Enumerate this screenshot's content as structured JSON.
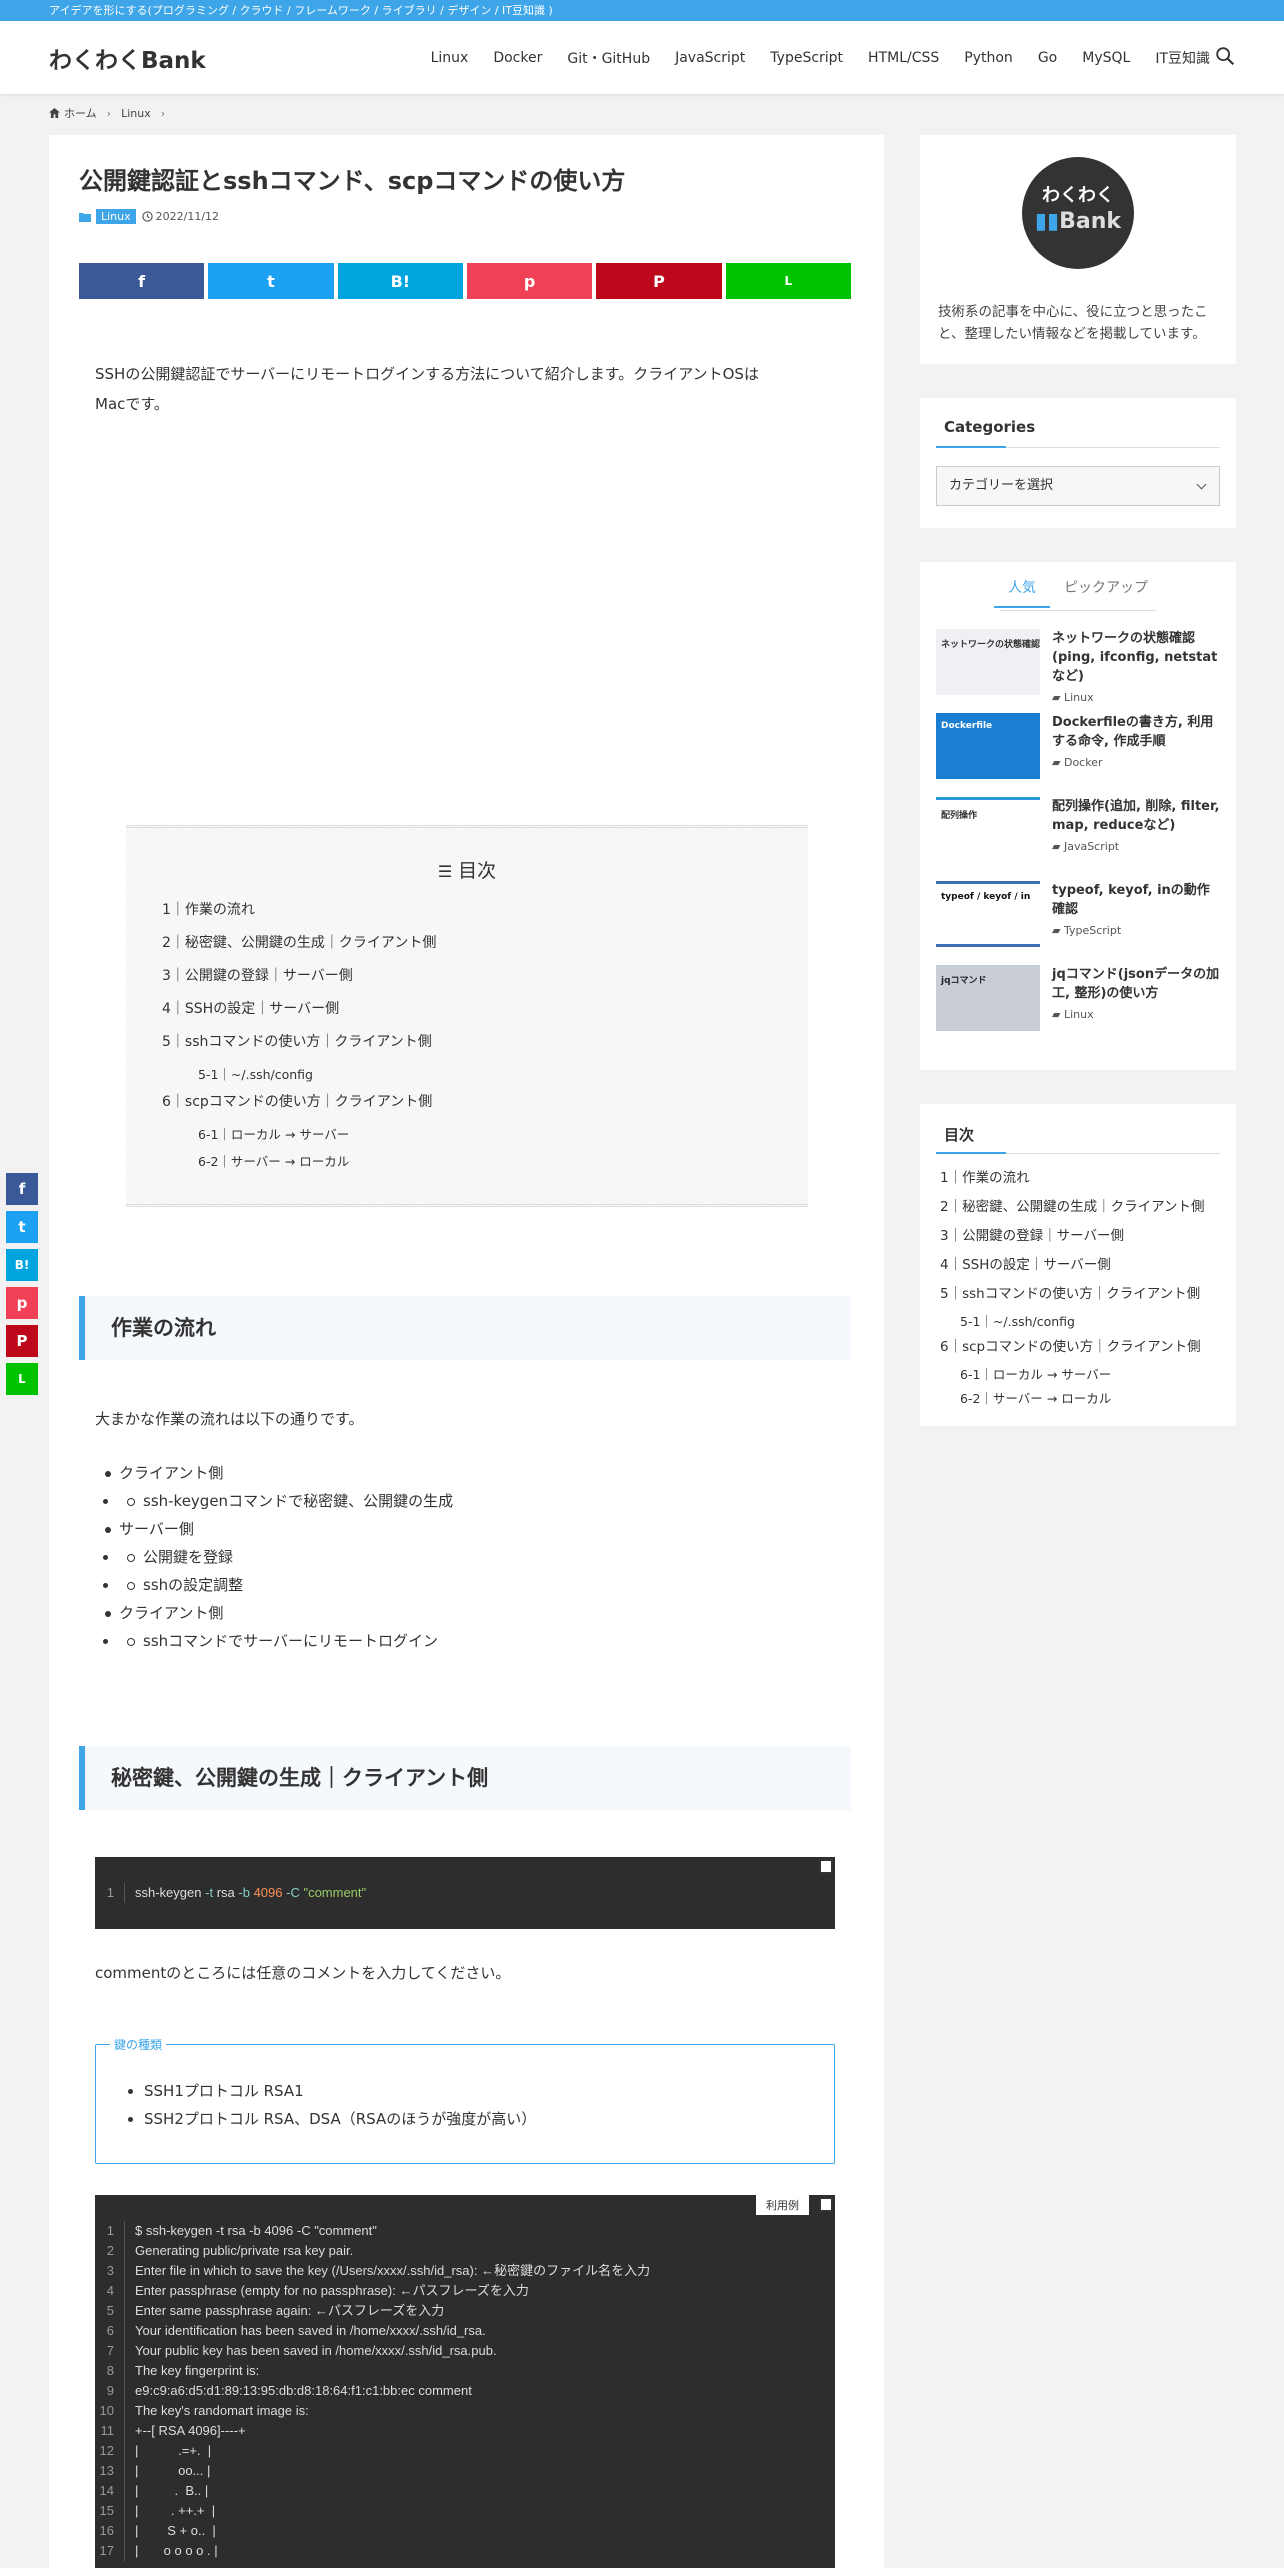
{
  "topbar": {
    "tagline": "アイデアを形にする(プログラミング / クラウド / フレームワーク / ライブラリ / デザイン / IT豆知識 )"
  },
  "header": {
    "logo": "わくわくBank",
    "nav": [
      "Linux",
      "Docker",
      "Git・GitHub",
      "JavaScript",
      "TypeScript",
      "HTML/CSS",
      "Python",
      "Go",
      "MySQL",
      "IT豆知識"
    ]
  },
  "breadcrumb": {
    "home": "ホーム",
    "category": "Linux"
  },
  "article": {
    "title": "公開鍵認証とsshコマンド、scpコマンドの使い方",
    "category": "Linux",
    "date": "2022/11/12",
    "intro_line1": "SSHの公開鍵認証でサーバーにリモートログインする方法について紹介します。クライアントOSは",
    "intro_line2": "Macです。",
    "toc_title": "目次",
    "toc": [
      {
        "label": "1｜作業の流れ"
      },
      {
        "label": "2｜秘密鍵、公開鍵の生成｜クライアント側"
      },
      {
        "label": "3｜公開鍵の登録｜サーバー側"
      },
      {
        "label": "4｜SSHの設定｜サーバー側"
      },
      {
        "label": "5｜sshコマンドの使い方｜クライアント側"
      },
      {
        "label": "5-1｜~/.ssh/config",
        "sub": true
      },
      {
        "label": "6｜scpコマンドの使い方｜クライアント側"
      },
      {
        "label": "6-1｜ローカル → サーバー",
        "sub": true
      },
      {
        "label": "6-2｜サーバー → ローカル",
        "sub": true
      }
    ],
    "section1_heading": "作業の流れ",
    "section1_text": "大まかな作業の流れは以下の通りです。",
    "flow": [
      {
        "label": "クライアント側",
        "level": 1
      },
      {
        "label": "ssh-keygenコマンドで秘密鍵、公開鍵の生成",
        "level": 2
      },
      {
        "label": "サーバー側",
        "level": 1
      },
      {
        "label": "公開鍵を登録",
        "level": 2
      },
      {
        "label": "sshの設定調整",
        "level": 2
      },
      {
        "label": "クライアント側",
        "level": 1
      },
      {
        "label": "sshコマンドでサーバーにリモートログイン",
        "level": 2
      }
    ],
    "section2_heading": "秘密鍵、公開鍵の生成｜クライアント側",
    "code1": {
      "line_no": "1",
      "cmd": "ssh-keygen",
      "opt1": "-t",
      "arg1": "rsa",
      "opt2": "-b",
      "num": "4096",
      "opt3": "-C",
      "str": "\"comment\""
    },
    "comment_note": "commentのところには任意のコメントを入力してください。",
    "keybox": {
      "label": "鍵の種類",
      "items": [
        "SSH1プロトコル RSA1",
        "SSH2プロトコル RSA、DSA（RSAのほうが強度が高い）"
      ]
    },
    "code2_tag": "利用例",
    "code2": [
      "$ ssh-keygen -t rsa -b 4096 -C \"comment\"",
      "Generating public/private rsa key pair.",
      "Enter file in which to save the key (/Users/xxxx/.ssh/id_rsa): ←秘密鍵のファイル名を入力",
      "Enter passphrase (empty for no passphrase): ←パスフレーズを入力",
      "Enter same passphrase again: ←パスフレーズを入力",
      "Your identification has been saved in /home/xxxx/.ssh/id_rsa.",
      "Your public key has been saved in /home/xxxx/.ssh/id_rsa.pub.",
      "The key fingerprint is:",
      "e9:c9:a6:d5:d1:89:13:95:db:d8:18:64:f1:c1:bb:ec comment",
      "The key's randomart image is:",
      "+--[ RSA 4096]----+",
      "|           .=+.  |",
      "|           oo... |",
      "|          .  B.. |",
      "|         . ++.+  |",
      "|        S + o..  |",
      "|       o o o o . |"
    ]
  },
  "share": {
    "facebook": "f",
    "twitter": "t",
    "hatena": "B!",
    "pocket": "p",
    "pinterest": "P",
    "line": "L"
  },
  "sidebar": {
    "profile_logo_top": "わくわく",
    "profile_logo_bottom": "Bank",
    "profile_text_line1": "技術系の記事を中心に、役に立つと思ったこ",
    "profile_text_line2": "と、整理したい情報などを掲載しています。",
    "categories_title": "Categories",
    "categories_placeholder": "カテゴリーを選択",
    "tab_popular": "人気",
    "tab_pickup": "ピックアップ",
    "posts": [
      {
        "title": "ネットワークの状態確認(ping, ifconfig, netstatなど)",
        "category": "Linux",
        "thumb_text": "ネットワークの状態確認"
      },
      {
        "title": "Dockerfileの書き方, 利用する命令, 作成手順",
        "category": "Docker",
        "thumb_text": "Dockerfile"
      },
      {
        "title": "配列操作(追加, 削除, filter, map, reduceなど)",
        "category": "JavaScript",
        "thumb_text": "配列操作"
      },
      {
        "title": "typeof, keyof, inの動作確認",
        "category": "TypeScript",
        "thumb_text": "typeof / keyof / in"
      },
      {
        "title": "jqコマンド(jsonデータの加工, 整形)の使い方",
        "category": "Linux",
        "thumb_text": "jqコマンド"
      }
    ],
    "toc_title": "目次"
  },
  "colors": {
    "accent": "#3ea6e8",
    "facebook": "#3b5998",
    "twitter": "#1da1f2",
    "hatena": "#00a4de",
    "pocket": "#ef4056",
    "pinterest": "#bd081c",
    "line": "#00c300"
  }
}
